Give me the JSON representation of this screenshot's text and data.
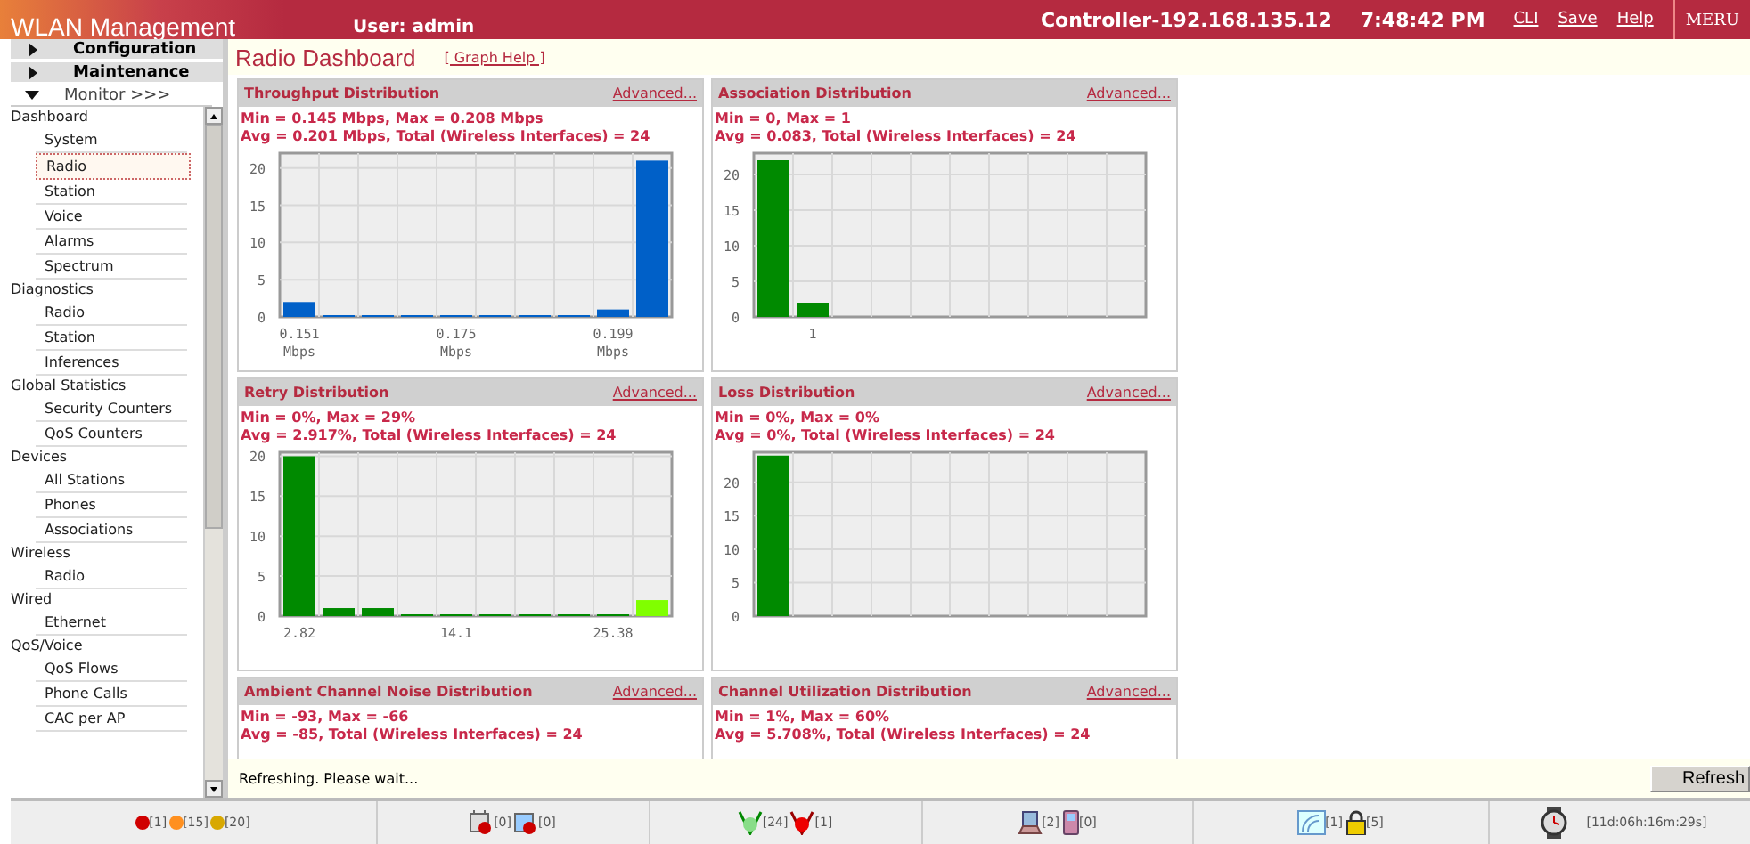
{
  "header": {
    "title": "WLAN Management",
    "user": "User: admin",
    "controller": "Controller-192.168.135.12",
    "time": "7:48:42 PM",
    "links": [
      "CLI",
      "Save",
      "Help"
    ],
    "logo": "MERU"
  },
  "sidebar": {
    "sections": [
      {
        "label": "Configuration",
        "expanded": false
      },
      {
        "label": "Maintenance",
        "expanded": false
      },
      {
        "label": "Monitor >>>",
        "expanded": true
      }
    ],
    "items": [
      {
        "label": "Dashboard",
        "children": [
          {
            "label": "System",
            "selected": false
          },
          {
            "label": "Radio",
            "selected": true
          },
          {
            "label": "Station",
            "selected": false
          },
          {
            "label": "Voice",
            "selected": false
          },
          {
            "label": "Alarms",
            "selected": false
          },
          {
            "label": "Spectrum",
            "selected": false
          }
        ]
      },
      {
        "label": "Diagnostics",
        "children": [
          {
            "label": "Radio",
            "selected": false
          },
          {
            "label": "Station",
            "selected": false
          },
          {
            "label": "Inferences",
            "selected": false
          }
        ]
      },
      {
        "label": "Global Statistics",
        "children": [
          {
            "label": "Security Counters",
            "selected": false
          },
          {
            "label": "QoS Counters",
            "selected": false
          }
        ]
      },
      {
        "label": "Devices",
        "children": [
          {
            "label": "All Stations",
            "selected": false
          },
          {
            "label": "Phones",
            "selected": false
          },
          {
            "label": "Associations",
            "selected": false
          }
        ]
      },
      {
        "label": "Wireless",
        "children": [
          {
            "label": "Radio",
            "selected": false
          }
        ]
      },
      {
        "label": "Wired",
        "children": [
          {
            "label": "Ethernet",
            "selected": false
          }
        ]
      },
      {
        "label": "QoS/Voice",
        "children": [
          {
            "label": "QoS Flows",
            "selected": false
          },
          {
            "label": "Phone Calls",
            "selected": false
          },
          {
            "label": "CAC per AP",
            "selected": false
          }
        ]
      }
    ]
  },
  "page": {
    "title": "Radio Dashboard",
    "help_link": "[ Graph Help ]"
  },
  "panels": [
    {
      "title": "Throughput Distribution",
      "link": "Advanced...",
      "stats": [
        "Min = 0.145 Mbps, Max = 0.208 Mbps",
        "Avg = 0.201 Mbps, Total (Wireless Interfaces) = 24"
      ],
      "chart_data": {
        "type": "bar",
        "grid": true,
        "ylim": [
          0,
          22
        ],
        "yticks": [
          0,
          5,
          10,
          15,
          20
        ],
        "categories": [
          "0.151 Mbps",
          null,
          null,
          null,
          "0.175 Mbps",
          null,
          null,
          null,
          "0.199 Mbps",
          null
        ],
        "series": [
          {
            "color": "#0060c8",
            "values": [
              2,
              0,
              0,
              0,
              0,
              0,
              0,
              0,
              1,
              21
            ]
          }
        ]
      }
    },
    {
      "title": "Association Distribution",
      "link": "Advanced...",
      "stats": [
        "Min = 0, Max = 1",
        "Avg = 0.083, Total (Wireless Interfaces) = 24"
      ],
      "chart_data": {
        "type": "bar",
        "grid": true,
        "ylim": [
          0,
          23
        ],
        "yticks": [
          0,
          5,
          10,
          15,
          20
        ],
        "categories": [
          null,
          "1",
          null,
          null,
          null,
          null,
          null,
          null,
          null,
          null
        ],
        "series": [
          {
            "color": "#008a00",
            "values": [
              22,
              2,
              null,
              null,
              null,
              null,
              null,
              null,
              null,
              null
            ]
          }
        ]
      }
    },
    {
      "title": "Retry Distribution",
      "link": "Advanced...",
      "stats": [
        "Min = 0%, Max = 29%",
        "Avg = 2.917%, Total (Wireless Interfaces) = 24"
      ],
      "chart_data": {
        "type": "bar",
        "grid": true,
        "ylim": [
          0,
          20.5
        ],
        "yticks": [
          0,
          5,
          10,
          15,
          20
        ],
        "categories": [
          "2.82",
          null,
          null,
          null,
          "14.1",
          null,
          null,
          null,
          "25.38",
          null
        ],
        "series": [
          {
            "color": "#008a00",
            "values": [
              20,
              1,
              1,
              0,
              0,
              0,
              0,
              0,
              0,
              null
            ]
          },
          {
            "color": "#80ff00",
            "values": [
              null,
              null,
              null,
              null,
              null,
              null,
              null,
              null,
              null,
              2
            ]
          }
        ]
      }
    },
    {
      "title": "Loss Distribution",
      "link": "Advanced...",
      "stats": [
        "Min = 0%, Max = 0%",
        "Avg = 0%, Total (Wireless Interfaces) = 24"
      ],
      "chart_data": {
        "type": "bar",
        "grid": true,
        "ylim": [
          0,
          24.5
        ],
        "yticks": [
          0,
          5,
          10,
          15,
          20
        ],
        "series": [
          {
            "color": "#008a00",
            "values": [
              24,
              null,
              null,
              null,
              null,
              null,
              null,
              null,
              null,
              null
            ]
          }
        ]
      }
    },
    {
      "title": "Ambient Channel Noise Distribution",
      "link": "Advanced...",
      "stats": [
        "Min = -93, Max = -66",
        "Avg = -85, Total (Wireless Interfaces) = 24"
      ]
    },
    {
      "title": "Channel Utilization Distribution",
      "link": "Advanced...",
      "stats": [
        "Min = 1%, Max = 60%",
        "Avg = 5.708%, Total (Wireless Interfaces) = 24"
      ]
    }
  ],
  "refresh_bar": {
    "message": "Refreshing. Please wait...",
    "button": "Refresh"
  },
  "status_bar": [
    {
      "items": [
        {
          "kind": "dot",
          "color": "#d00000",
          "count": "[1]"
        },
        {
          "kind": "dot",
          "color": "#ff9020",
          "count": "[15]"
        },
        {
          "kind": "dot",
          "color": "#d8a800",
          "count": "[20]"
        }
      ]
    },
    {
      "items": [
        {
          "kind": "ap-down",
          "count": "[0]"
        },
        {
          "kind": "ap-alert",
          "count": "[0]"
        }
      ]
    },
    {
      "items": [
        {
          "kind": "ap-up",
          "count": "[24]"
        },
        {
          "kind": "ap-fault",
          "count": "[1]"
        }
      ]
    },
    {
      "items": [
        {
          "kind": "laptop",
          "count": "[2]"
        },
        {
          "kind": "phone",
          "count": "[0]"
        }
      ]
    },
    {
      "items": [
        {
          "kind": "wifi",
          "count": "[1]"
        },
        {
          "kind": "lock",
          "count": "[5]"
        }
      ]
    },
    {
      "items": [
        {
          "kind": "clock",
          "count": "[11d:06h:16m:29s]"
        }
      ]
    }
  ]
}
